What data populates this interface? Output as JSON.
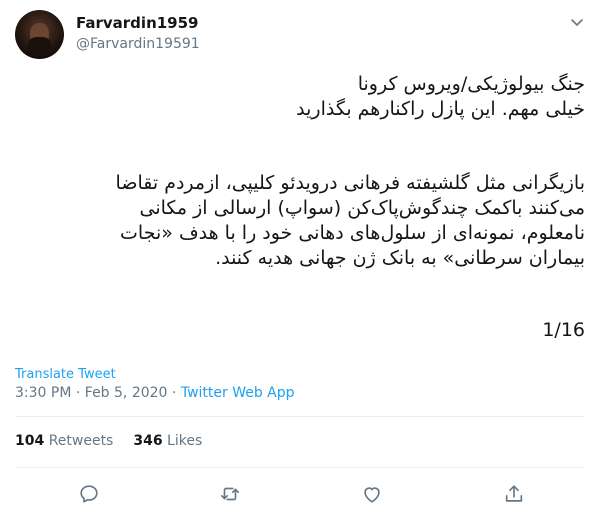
{
  "user": {
    "display_name": "Farvardin1959",
    "handle": "@Farvardin19591"
  },
  "tweet": {
    "lines_block1": [
      "جنگ بیولوژیکی/ویروس کرونا",
      "خیلی مهم.  این پازل راکنارهم بگذارید"
    ],
    "lines_block2": [
      "بازیگرانی مثل گلشیفته فرهانی درویدئو کلیپی، ازمردم تقاضا",
      "می‌کنند باکمک چندگوش‌پاک‌کن (سواپ) ارسالی از مکانی",
      "نامعلوم، نمونه‌ای از سلول‌های دهانی خود را با هدف «نجات",
      "بیماران سرطانی» به بانک ژن جهانی هدیه کنند."
    ],
    "thread_counter": "1/16"
  },
  "translate_label": "Translate Tweet",
  "meta": {
    "time": "3:30 PM",
    "separator": " · ",
    "date": "Feb 5, 2020",
    "source": "Twitter Web App"
  },
  "stats": {
    "retweets_count": "104",
    "retweets_label": "Retweets",
    "likes_count": "346",
    "likes_label": "Likes"
  },
  "icons": [
    "chevron-down-icon",
    "reply-icon",
    "retweet-icon",
    "like-icon",
    "share-icon"
  ],
  "colors": {
    "link": "#1da1f2",
    "muted": "#657786",
    "text": "#14171a",
    "divider": "#e6ecf0"
  }
}
